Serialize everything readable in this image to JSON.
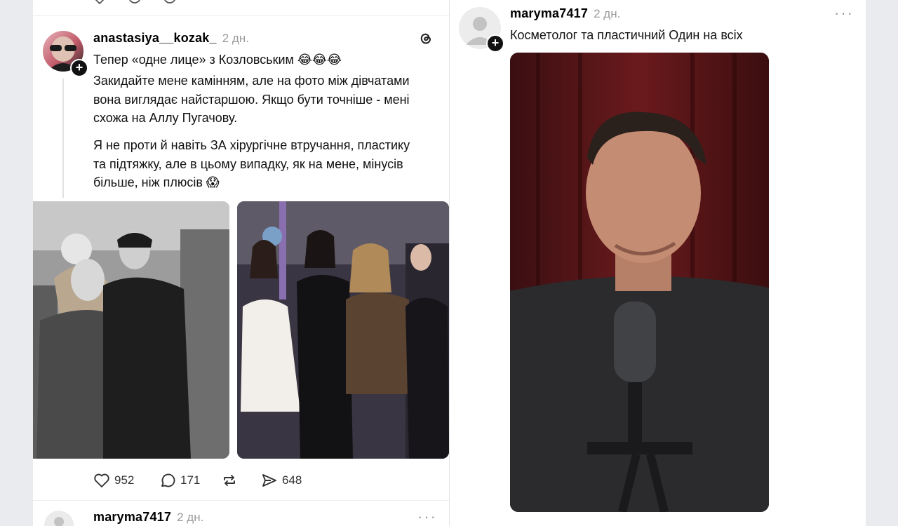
{
  "left_post": {
    "username": "anastasiya__kozak_",
    "time": "2 дн.",
    "paragraph1": "Тепер «одне лице» з Козловським 😂😂😂",
    "paragraph2": "Закидайте мене камінням, але на фото між дівчатами вона виглядає найстаршою. Якщо бути точніше - мені схожа на Аллу Пугачову.",
    "paragraph3": "Я не проти й навіть ЗА хірургічне втручання, пластику та підтяжку, але в цьому випадку, як на мене, мінусів більше, ніж плюсів 😱",
    "images": [
      "photo-couple",
      "photo-group"
    ],
    "actions": {
      "likes": "952",
      "replies": "171",
      "shares": "648"
    }
  },
  "left_next_post": {
    "username": "maryma7417",
    "time": "2 дн."
  },
  "right_post": {
    "username": "maryma7417",
    "time": "2 дн.",
    "text": "Косметолог та пластичний Один на всіх"
  },
  "colors": {
    "background": "#eaebee",
    "panel": "#ffffff",
    "muted_text": "#9a9a9a"
  }
}
